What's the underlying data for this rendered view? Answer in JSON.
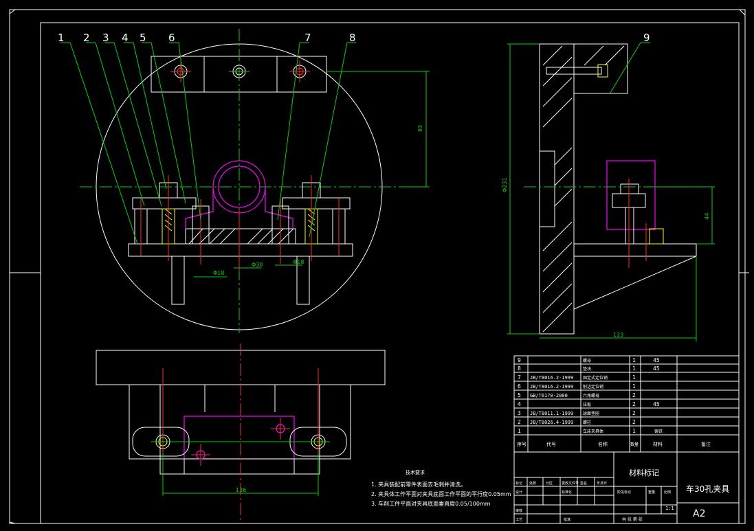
{
  "drawing": {
    "part_numbers": [
      "1",
      "2",
      "3",
      "4",
      "5",
      "6",
      "7",
      "8",
      "9"
    ],
    "dimensions": {
      "front_height": "93",
      "side_height": "Φ231",
      "side_width": "123",
      "side_right_height": "44",
      "top_width": "136",
      "bore_left": "Φ18",
      "bore_center": "Φ30",
      "bore_right": "Φ18"
    },
    "tech_requirements": {
      "title": "技术要求",
      "items": [
        "1. 夹具装配前零件表面去毛刺并清洗。",
        "2. 夹具体工作平面对夹具底面工作平面的平行度0.05mm",
        "3. 车削工件平面对夹具底面垂直度0.05/100mm"
      ]
    },
    "bom": [
      {
        "no": "9",
        "code": "",
        "name": "螺母",
        "qty": "1",
        "material": "45"
      },
      {
        "no": "8",
        "code": "",
        "name": "垫块",
        "qty": "1",
        "material": "45"
      },
      {
        "no": "7",
        "code": "JB/T8016.2-1999",
        "name": "固定式定位销",
        "qty": "1",
        "material": ""
      },
      {
        "no": "6",
        "code": "JB/T8016.2-1999",
        "name": "削边定位销",
        "qty": "1",
        "material": ""
      },
      {
        "no": "5",
        "code": "GB/T6170-2000",
        "name": "六角螺母",
        "qty": "2",
        "material": ""
      },
      {
        "no": "4",
        "code": "",
        "name": "压板",
        "qty": "2",
        "material": "45"
      },
      {
        "no": "3",
        "code": "JB/T8011.1-1999",
        "name": "球面垫圈",
        "qty": "2",
        "material": ""
      },
      {
        "no": "2",
        "code": "JB/T8026.4-1999",
        "name": "螺柱",
        "qty": "2",
        "material": ""
      },
      {
        "no": "1",
        "code": "",
        "name": "车床夹具体",
        "qty": "1",
        "material": "铸铁"
      }
    ],
    "bom_headers": {
      "no": "序号",
      "code": "代号",
      "name": "名称",
      "qty": "数量",
      "material": "材料",
      "remark": "备注"
    },
    "title_block": {
      "material_mark": "材料标记",
      "title": "车30孔夹具",
      "drawing_no": "A2",
      "scale": "1:1",
      "row_labels": [
        "标记",
        "处数",
        "分区",
        "更改文件号",
        "签名",
        "年月日"
      ],
      "row_labels2": [
        "设计",
        "标准化",
        "阶段标记",
        "重量",
        "比例"
      ],
      "row_labels3": [
        "审核",
        "工艺",
        "批准"
      ],
      "sheet_text": "共 张 第 张"
    }
  }
}
